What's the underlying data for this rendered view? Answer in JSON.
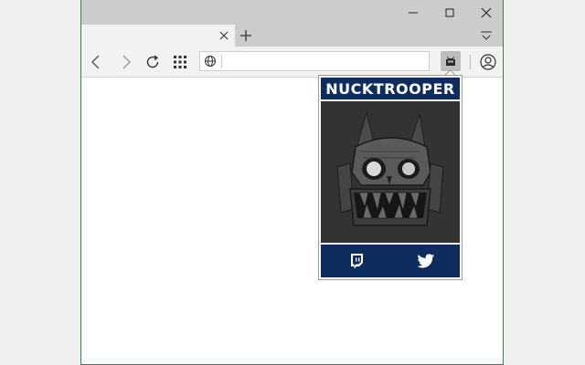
{
  "browser": {
    "window_controls": {
      "minimize_icon": "minimize-icon",
      "maximize_icon": "maximize-icon",
      "close_icon": "close-icon"
    },
    "tab": {
      "title": "",
      "close_icon": "close-icon"
    },
    "new_tab_icon": "plus-icon",
    "tab_menu_icon": "tab-menu-icon",
    "toolbar": {
      "back_icon": "back-arrow-icon",
      "forward_icon": "forward-arrow-icon",
      "refresh_icon": "refresh-icon",
      "apps_icon": "grid-icon",
      "extension_icon": "nucktrooper-extension-icon",
      "profile_icon": "profile-icon"
    },
    "address_bar": {
      "value": "",
      "placeholder": "",
      "icon": "globe-icon"
    }
  },
  "popup": {
    "title": "NUCKTROOPER",
    "image": "monster-skull-artwork",
    "links": [
      {
        "name": "twitch",
        "icon": "twitch-icon"
      },
      {
        "name": "twitter",
        "icon": "twitter-icon"
      }
    ]
  },
  "colors": {
    "brand_navy": "#0e2d5e",
    "image_bg": "#333333",
    "window_border": "#2f8a3e",
    "chrome": "#cccccc",
    "toolbar": "#f2f2f2"
  }
}
